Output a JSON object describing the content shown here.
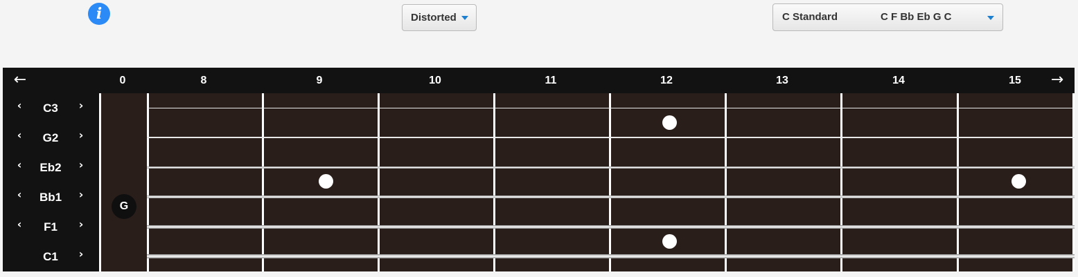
{
  "info": {
    "glyph": "i"
  },
  "sound": {
    "value": "Distorted"
  },
  "tuning": {
    "name": "C Standard",
    "notes": "C F Bb Eb G C"
  },
  "nav": {
    "left": "←",
    "right": "→"
  },
  "fret_labels": [
    "0",
    "8",
    "9",
    "10",
    "11",
    "12",
    "13",
    "14",
    "15"
  ],
  "strings": [
    {
      "name": "C3",
      "has_left": true,
      "has_right": true
    },
    {
      "name": "G2",
      "has_left": true,
      "has_right": true
    },
    {
      "name": "Eb2",
      "has_left": true,
      "has_right": true
    },
    {
      "name": "Bb1",
      "has_left": true,
      "has_right": true
    },
    {
      "name": "F1",
      "has_left": true,
      "has_right": true
    },
    {
      "name": "C1",
      "has_left": false,
      "has_right": true
    }
  ],
  "chevrons": {
    "left": "‹",
    "right": "›"
  },
  "open_note": {
    "label": "G",
    "string": "G2"
  },
  "colors": {
    "fretboard": "#2a1e1b",
    "header": "#121212",
    "info": "#2b8af6",
    "caret": "#1d7fcf"
  }
}
